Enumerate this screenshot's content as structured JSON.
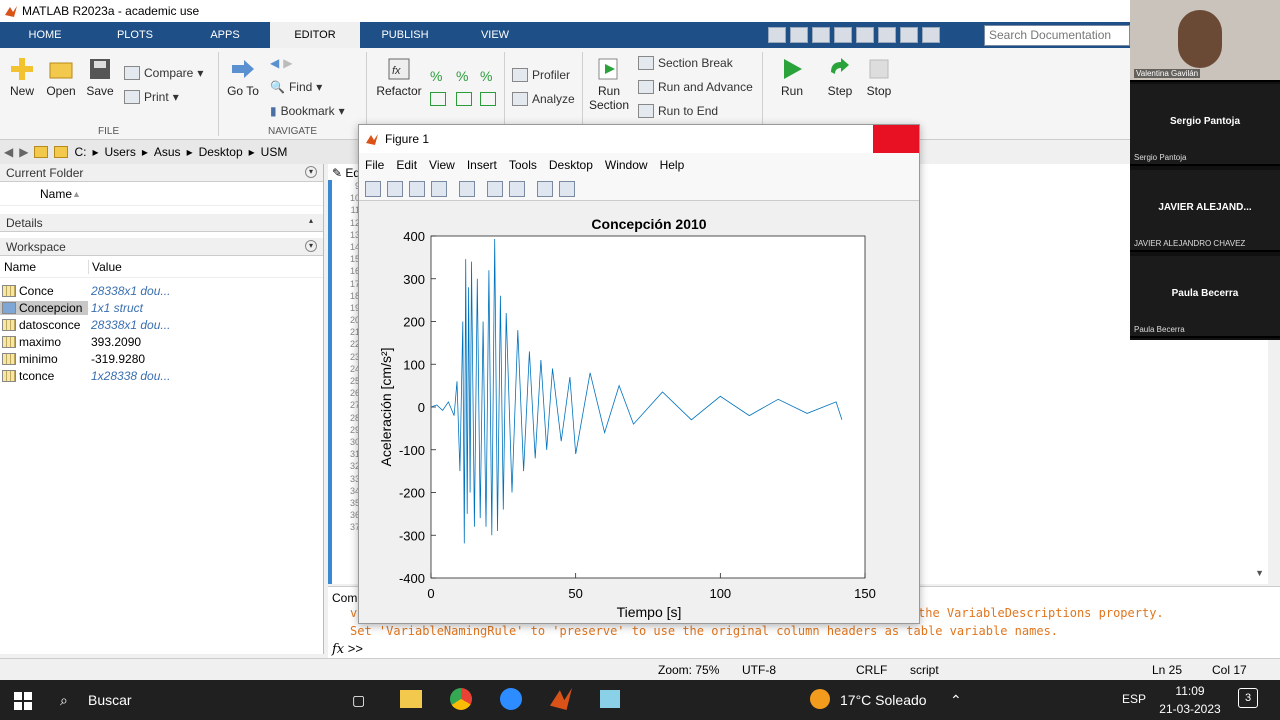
{
  "window": {
    "title": "MATLAB R2023a - academic use"
  },
  "tabs": [
    "HOME",
    "PLOTS",
    "APPS",
    "EDITOR",
    "PUBLISH",
    "VIEW"
  ],
  "active_tab": "EDITOR",
  "doc_search": {
    "placeholder": "Search Documentation"
  },
  "ribbon": {
    "new": "New",
    "open": "Open",
    "save": "Save",
    "compare": "Compare",
    "print": "Print",
    "goto": "Go To",
    "find": "Find",
    "bookmark": "Bookmark",
    "refactor": "Refactor",
    "profiler": "Profiler",
    "analyze": "Analyze",
    "run_section": "Run Section",
    "section_break": "Section Break",
    "run_and_advance": "Run and Advance",
    "run_to_end": "Run to End",
    "run": "Run",
    "step": "Step",
    "stop": "Stop",
    "group_file": "FILE",
    "group_navigate": "NAVIGATE"
  },
  "address": [
    "C:",
    "Users",
    "Asus",
    "Desktop",
    "USM"
  ],
  "current_folder": {
    "title": "Current Folder",
    "col_name": "Name"
  },
  "details": {
    "title": "Details"
  },
  "workspace": {
    "title": "Workspace",
    "col_name": "Name",
    "col_value": "Value",
    "rows": [
      {
        "name": "Conce",
        "value": "28338x1 dou..."
      },
      {
        "name": "Concepcion",
        "value": "1x1 struct"
      },
      {
        "name": "datosconce",
        "value": "28338x1 dou..."
      },
      {
        "name": "maximo",
        "value": "393.2090"
      },
      {
        "name": "minimo",
        "value": "-319.9280"
      },
      {
        "name": "tconce",
        "value": "1x28338 dou..."
      }
    ]
  },
  "editor": {
    "tab_label": "Ed",
    "line_numbers": [
      "9",
      "10",
      "11",
      "12",
      "13",
      "14",
      "15",
      "16",
      "17",
      "18",
      "19",
      "20",
      "21",
      "22",
      "23",
      "24",
      "25",
      "26",
      "27",
      "28",
      "29",
      "30",
      "31",
      "32",
      "33",
      "34",
      "35",
      "36",
      "37"
    ]
  },
  "command_window": {
    "label": "Com",
    "line1_prefix": "v",
    "line1_suffix": "the VariableDescriptions property.",
    "line2": "Set 'VariableNamingRule' to 'preserve' to use the original column headers as table variable names.",
    "prompt": ">>"
  },
  "figure": {
    "title": "Figure 1",
    "menu": [
      "File",
      "Edit",
      "View",
      "Insert",
      "Tools",
      "Desktop",
      "Window",
      "Help"
    ]
  },
  "chart_data": {
    "type": "line",
    "title": "Concepción 2010",
    "xlabel": "Tiempo [s]",
    "ylabel": "Aceleración [cm/s²]",
    "xlim": [
      0,
      150
    ],
    "ylim": [
      -400,
      400
    ],
    "xticks": [
      0,
      50,
      100,
      150
    ],
    "yticks": [
      400,
      300,
      200,
      100,
      0,
      -100,
      -200,
      -300,
      -400
    ],
    "color": "#0072bd",
    "grid": false,
    "series": [
      {
        "x": [
          0,
          2,
          4,
          6,
          8,
          9,
          10,
          11,
          11.5,
          12,
          12.5,
          13,
          13.5,
          14,
          15,
          16,
          17,
          18,
          19,
          20,
          21,
          22,
          23,
          24,
          25,
          26,
          28,
          30,
          32,
          34,
          36,
          38,
          40,
          42,
          45,
          48,
          50,
          55,
          60,
          65,
          70,
          80,
          90,
          100,
          110,
          120,
          130,
          140,
          142
        ],
        "y": [
          0,
          5,
          -8,
          12,
          -20,
          60,
          -150,
          200,
          -319,
          346,
          -250,
          280,
          -200,
          340,
          -280,
          300,
          -260,
          200,
          -280,
          320,
          -300,
          393,
          -290,
          260,
          -240,
          220,
          -200,
          180,
          -150,
          130,
          -120,
          110,
          -100,
          90,
          -80,
          70,
          -110,
          80,
          -60,
          50,
          -40,
          35,
          -30,
          25,
          -20,
          18,
          -15,
          12,
          -30
        ]
      }
    ]
  },
  "participants": [
    {
      "name": "Valentina Gavilán",
      "label": "Valentina Gavilán"
    },
    {
      "name": "Sergio Pantoja",
      "label": "Sergio Pantoja"
    },
    {
      "name": "JAVIER ALEJAND...",
      "label": "JAVIER ALEJANDRO CHAVEZ"
    },
    {
      "name": "Paula Becerra",
      "label": "Paula Becerra"
    }
  ],
  "status": {
    "zoom": "Zoom: 75%",
    "encoding": "UTF-8",
    "eol": "CRLF",
    "type": "script",
    "line": "Ln 25",
    "col": "Col 17"
  },
  "taskbar": {
    "search": "Buscar",
    "weather": "17°C Soleado",
    "lang": "ESP",
    "time": "11:09",
    "date": "21-03-2023",
    "notif": "3"
  }
}
